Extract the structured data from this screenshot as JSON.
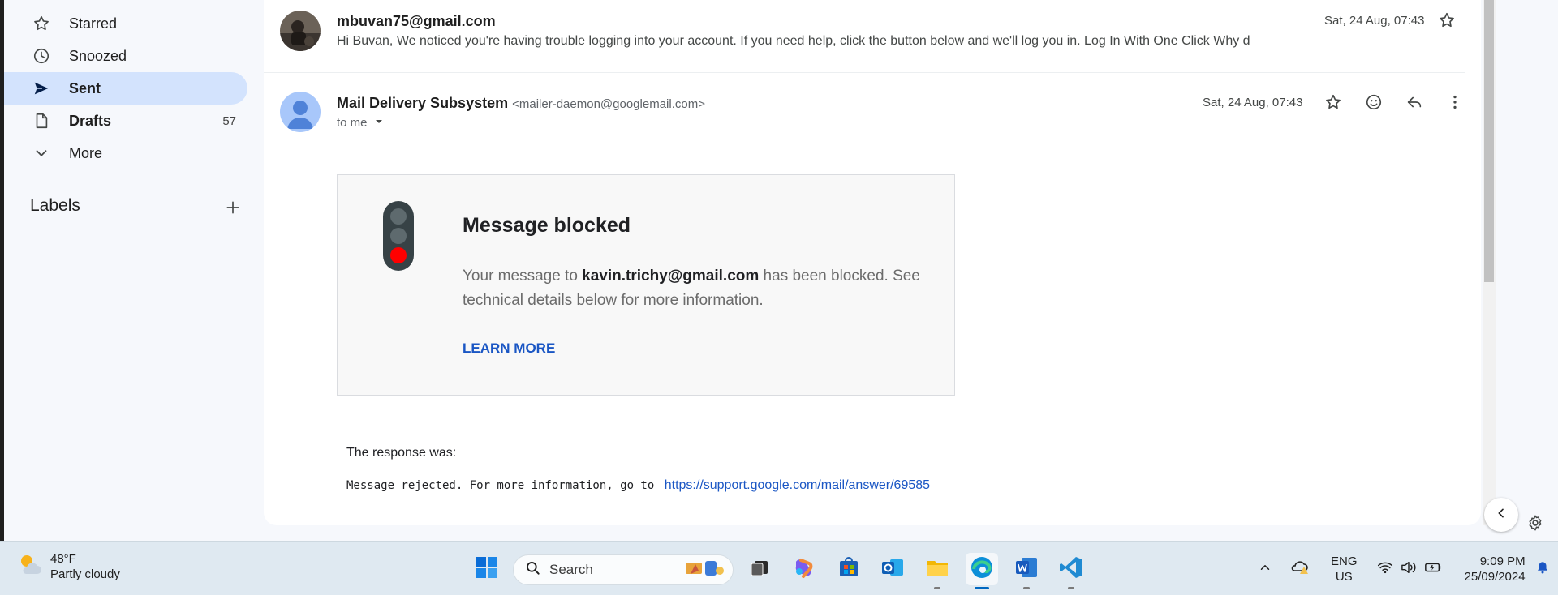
{
  "sidebar": {
    "items": [
      {
        "label": "Starred",
        "icon": "star-outline-icon"
      },
      {
        "label": "Snoozed",
        "icon": "clock-icon"
      },
      {
        "label": "Sent",
        "icon": "send-icon"
      },
      {
        "label": "Drafts",
        "icon": "draft-icon",
        "count": "57"
      },
      {
        "label": "More",
        "icon": "chevron-down-icon"
      }
    ],
    "labels_header": "Labels"
  },
  "thread": {
    "collapsed": {
      "sender": "mbuvan75@gmail.com",
      "snippet": "Hi Buvan, We noticed you're having trouble logging into your account. If you need help, click the button below and we'll log you in. Log In With One Click Why d",
      "date": "Sat, 24 Aug, 07:43"
    },
    "open": {
      "sender_name": "Mail Delivery Subsystem",
      "sender_email": "<mailer-daemon@googlemail.com>",
      "to": "to me",
      "date": "Sat, 24 Aug, 07:43",
      "bounce": {
        "title": "Message blocked",
        "text_prefix": "Your message to ",
        "recipient": "kavin.trichy@gmail.com",
        "text_suffix": " has been blocked. See technical details below for more information.",
        "learn_more": "LEARN MORE"
      },
      "response_label": "The response was:",
      "response_text": "Message rejected. For more information, go to",
      "response_link": "https://support.google.com/mail/answer/69585"
    }
  },
  "taskbar": {
    "weather_temp": "48°F",
    "weather_desc": "Partly cloudy",
    "search_placeholder": "Search",
    "lang_top": "ENG",
    "lang_bottom": "US",
    "time": "9:09 PM",
    "date": "25/09/2024"
  },
  "colors": {
    "accent_blue": "#1a56c4",
    "active_nav": "#d3e3fd",
    "traffic_red": "#ff0000"
  }
}
